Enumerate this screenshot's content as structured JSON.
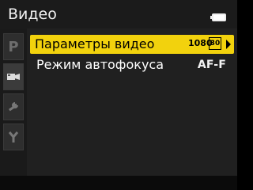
{
  "topbar": {
    "title": "Видео",
    "battery_icon": "battery-icon"
  },
  "tabs": [
    {
      "name": "tab-playback",
      "letter": "P",
      "icon": "p-letter-icon"
    },
    {
      "name": "tab-movie",
      "icon": "camera-icon"
    },
    {
      "name": "tab-setup",
      "icon": "wrench-icon"
    },
    {
      "name": "tab-custom",
      "icon": "y-icon"
    }
  ],
  "menu": {
    "items": [
      {
        "label": "Параметры видео",
        "value_top": "1080",
        "value_box": "30",
        "selected": true,
        "right_icon": "chevron-right-icon"
      },
      {
        "label": "Режим автофокуса",
        "value": "AF-F",
        "selected": false
      }
    ]
  },
  "colors": {
    "highlight": "#f2d20d",
    "bg": "#202020",
    "topbar": "#1b1b1b"
  }
}
